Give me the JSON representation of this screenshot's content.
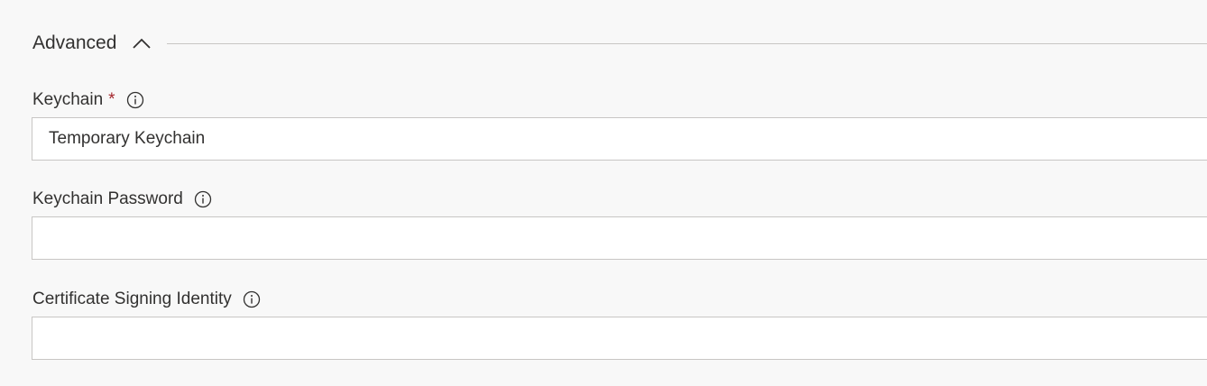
{
  "section": {
    "title": "Advanced",
    "chevron_icon": "chevron-up-icon",
    "expanded": true
  },
  "fields": {
    "keychain": {
      "label": "Keychain",
      "required_marker": "*",
      "value": "Temporary Keychain",
      "info_icon": "info-icon"
    },
    "keychain_password": {
      "label": "Keychain Password",
      "value": "",
      "info_icon": "info-icon"
    },
    "certificate_signing_identity": {
      "label": "Certificate Signing Identity",
      "value": "",
      "info_icon": "info-icon"
    }
  },
  "colors": {
    "background": "#f8f8f8",
    "input_background": "#ffffff",
    "border": "#c8c6c4",
    "text": "#323130",
    "required": "#a4262c"
  }
}
